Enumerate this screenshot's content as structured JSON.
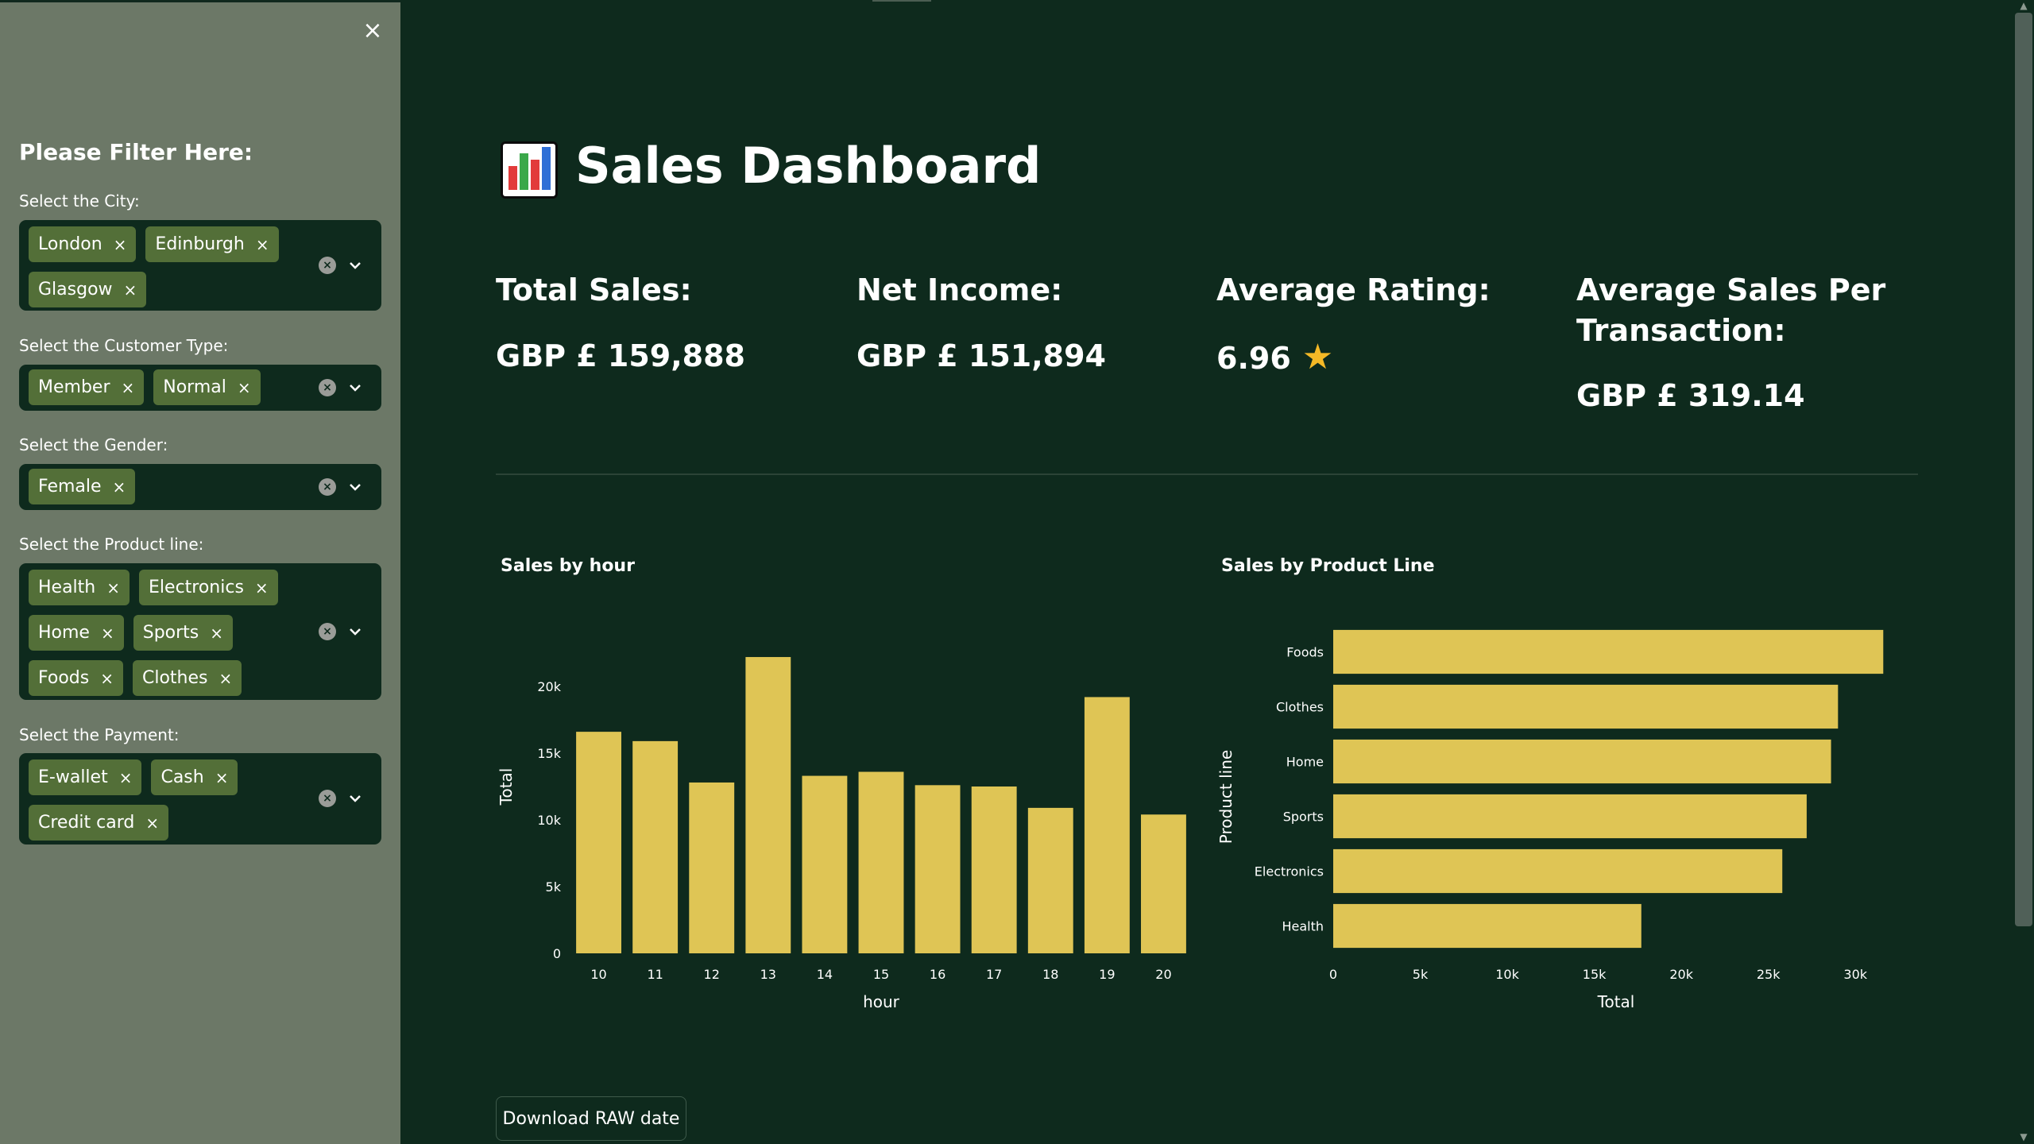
{
  "sidebar": {
    "title": "Please Filter Here:",
    "close_icon": "close-icon",
    "filters": [
      {
        "label": "Select the City:",
        "chips": [
          "London",
          "Edinburgh",
          "Glasgow"
        ]
      },
      {
        "label": "Select the Customer Type:",
        "chips": [
          "Member",
          "Normal"
        ]
      },
      {
        "label": "Select the Gender:",
        "chips": [
          "Female"
        ]
      },
      {
        "label": "Select the Product line:",
        "chips": [
          "Health",
          "Electronics",
          "Home",
          "Sports",
          "Foods",
          "Clothes"
        ]
      },
      {
        "label": "Select the Payment:",
        "chips": [
          "E-wallet",
          "Cash",
          "Credit card"
        ]
      }
    ],
    "chip_remove_glyph": "×",
    "clear_glyph": "×"
  },
  "header": {
    "title": "Sales Dashboard",
    "icon": "bar-chart-icon"
  },
  "metrics": {
    "total_sales": {
      "label": "Total Sales:",
      "value": "GBP £ 159,888"
    },
    "net_income": {
      "label": "Net Income:",
      "value": "GBP £ 151,894"
    },
    "average_rating": {
      "label": "Average Rating:",
      "value": "6.96",
      "icon": "star-icon",
      "glyph": "★"
    },
    "avg_sales_per_txn": {
      "label": "Average Sales Per Transaction:",
      "value": "GBP £ 319.14"
    }
  },
  "colors": {
    "background": "#0e2a1d",
    "sidebar": "#6c7867",
    "bar": "#dfc555",
    "chip": "#536f38"
  },
  "chart_data": [
    {
      "type": "bar",
      "title": "Sales by hour",
      "xlabel": "hour",
      "ylabel": "Total",
      "categories": [
        "10",
        "11",
        "12",
        "13",
        "14",
        "15",
        "16",
        "17",
        "18",
        "19",
        "20"
      ],
      "values": [
        16600,
        15900,
        12800,
        22200,
        13300,
        13600,
        12600,
        12500,
        10900,
        19200,
        10400
      ],
      "ylim": [
        0,
        25000
      ],
      "yticks": [
        0,
        5000,
        10000,
        15000,
        20000
      ],
      "yticklabels": [
        "0",
        "5k",
        "10k",
        "15k",
        "20k"
      ]
    },
    {
      "type": "bar",
      "orientation": "horizontal",
      "title": "Sales by Product Line",
      "xlabel": "Total",
      "ylabel": "Product line",
      "categories": [
        "Foods",
        "Clothes",
        "Home",
        "Sports",
        "Electronics",
        "Health"
      ],
      "values": [
        31600,
        29000,
        28600,
        27200,
        25800,
        17700
      ],
      "xlim": [
        0,
        32500
      ],
      "xticks": [
        0,
        5000,
        10000,
        15000,
        20000,
        25000,
        30000
      ],
      "xticklabels": [
        "0",
        "5k",
        "10k",
        "15k",
        "20k",
        "25k",
        "30k"
      ]
    }
  ],
  "actions": {
    "download_label": "Download RAW date"
  }
}
